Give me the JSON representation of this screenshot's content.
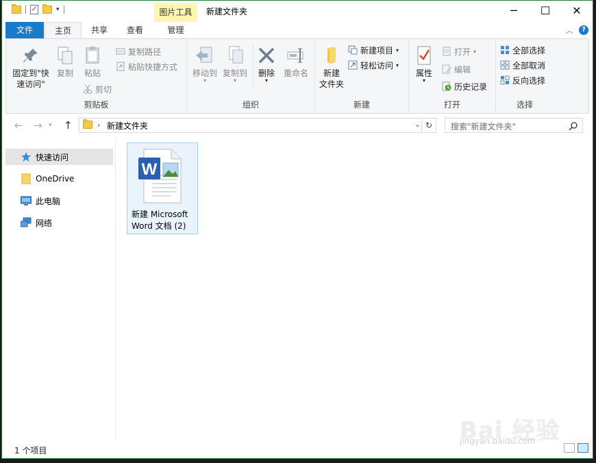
{
  "titlebar": {
    "context_tab_label": "图片工具",
    "window_title": "新建文件夹",
    "minimize": "─",
    "maximize": "☐",
    "close": "✕"
  },
  "tabs": {
    "file": "文件",
    "home": "主页",
    "share": "共享",
    "view": "查看",
    "manage": "管理",
    "help": "?"
  },
  "ribbon": {
    "clipboard": {
      "label": "剪贴板",
      "pin_line1": "固定到\"快",
      "pin_line2": "速访问\"",
      "copy": "复制",
      "paste": "粘贴",
      "copy_path": "复制路径",
      "paste_shortcut": "粘贴快捷方式",
      "cut": "剪切"
    },
    "organize": {
      "label": "组织",
      "move_to": "移动到",
      "copy_to": "复制到",
      "delete": "删除",
      "rename": "重命名"
    },
    "new": {
      "label": "新建",
      "new_folder_line1": "新建",
      "new_folder_line2": "文件夹",
      "new_item": "新建项目",
      "easy_access": "轻松访问"
    },
    "open": {
      "label": "打开",
      "properties": "属性",
      "open": "打开",
      "edit": "编辑",
      "history": "历史记录"
    },
    "select": {
      "label": "选择",
      "select_all": "全部选择",
      "select_none": "全部取消",
      "invert": "反向选择"
    }
  },
  "address": {
    "path": "新建文件夹",
    "search_placeholder": "搜索\"新建文件夹\""
  },
  "nav": {
    "items": [
      {
        "label": "快速访问"
      },
      {
        "label": "OneDrive"
      },
      {
        "label": "此电脑"
      },
      {
        "label": "网络"
      }
    ]
  },
  "files": [
    {
      "line1": "新建 Microsoft",
      "line2": "Word 文档 (2)"
    }
  ],
  "status": {
    "count": "1 个项目"
  },
  "watermark": {
    "brand": "Bai 经验",
    "url": "jingyan.baidu.com"
  },
  "colors": {
    "accent": "#1979ca",
    "context_tab": "#fdf6b3",
    "selection": "#e8f3fb"
  }
}
